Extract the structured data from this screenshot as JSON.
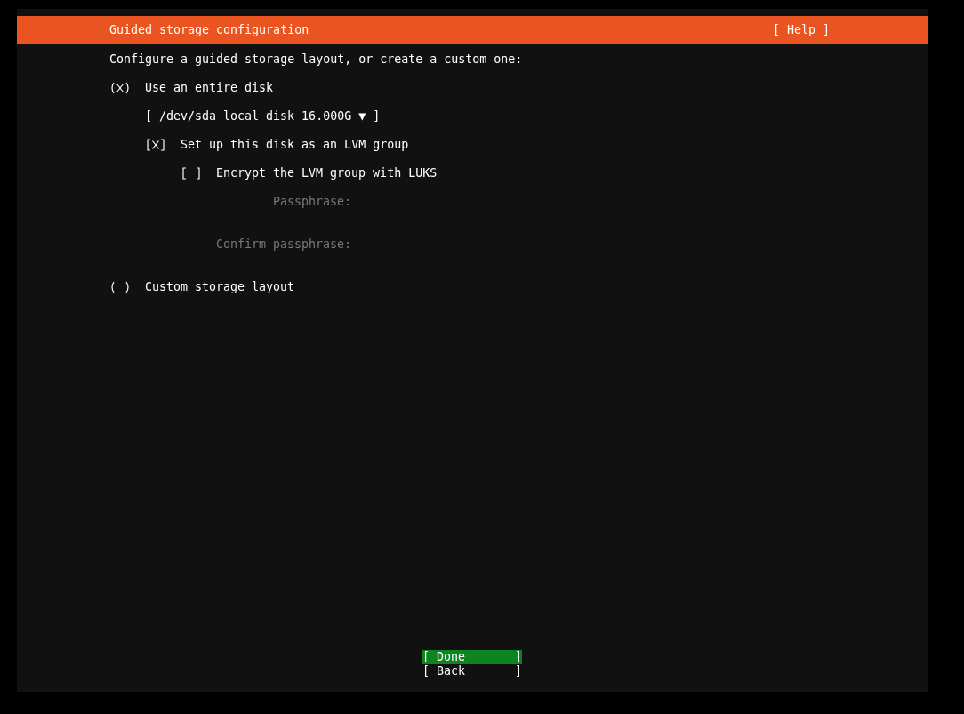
{
  "header": {
    "title": "Guided storage configuration",
    "help": "[ Help ]"
  },
  "intro": "Configure a guided storage layout, or create a custom one:",
  "options": [
    {
      "label": "Use an entire disk",
      "selected": true,
      "disk_dropdown": "[ /dev/sda local disk 16.000G ▼ ]",
      "lvm": {
        "label": "Set up this disk as an LVM group",
        "checked": true,
        "encrypt": {
          "label": "Encrypt the LVM group with LUKS",
          "checked": false,
          "fields": [
            {
              "label": "Passphrase:",
              "disabled": true
            },
            {
              "label": "Confirm passphrase:",
              "disabled": true
            }
          ]
        }
      }
    },
    {
      "label": "Custom storage layout",
      "selected": false
    }
  ],
  "buttons": [
    {
      "label": "[ Done       ]",
      "selected": true
    },
    {
      "label": "[ Back       ]",
      "selected": false
    }
  ]
}
